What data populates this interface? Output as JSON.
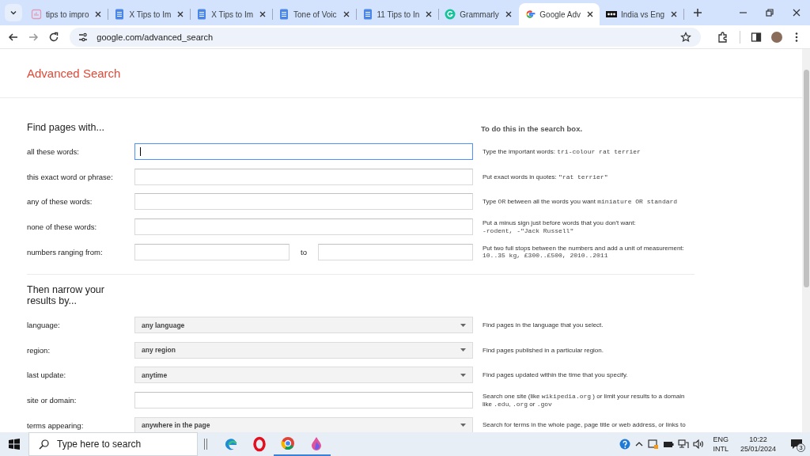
{
  "browser": {
    "tabs": [
      {
        "title": "tips to impro",
        "kind": "chart",
        "selected": false
      },
      {
        "title": "X Tips to Im",
        "kind": "doc",
        "selected": false
      },
      {
        "title": "X Tips to Im",
        "kind": "doc",
        "selected": false
      },
      {
        "title": "Tone of Voic",
        "kind": "doc",
        "selected": false
      },
      {
        "title": "11 Tips to In",
        "kind": "doc",
        "selected": false
      },
      {
        "title": "Grammarly",
        "kind": "grammarly",
        "selected": false
      },
      {
        "title": "Google Adv",
        "kind": "google",
        "selected": true
      },
      {
        "title": "India vs Eng",
        "kind": "dots",
        "selected": false
      }
    ],
    "url": "google.com/advanced_search"
  },
  "page": {
    "title": "Advanced Search",
    "sections": [
      {
        "heading": "Find pages with...",
        "side_heading": "To do this in the search box.",
        "rows": [
          {
            "label": "all these words:",
            "kind": "text",
            "focused": true,
            "hint": [
              {
                "kind": "text",
                "text": "Type the important words: "
              },
              {
                "kind": "code",
                "text": "tri-colour rat terrier"
              }
            ]
          },
          {
            "label": "this exact word or phrase:",
            "kind": "text",
            "focused": false,
            "hint": [
              {
                "kind": "text",
                "text": "Put exact words in quotes: "
              },
              {
                "kind": "code",
                "text": "\"rat terrier\""
              }
            ]
          },
          {
            "label": "any of these words:",
            "kind": "text",
            "focused": false,
            "hint": [
              {
                "kind": "text",
                "text": "Type "
              },
              {
                "kind": "code",
                "text": "OR"
              },
              {
                "kind": "text",
                "text": " between all the words you want "
              },
              {
                "kind": "code",
                "text": "miniature OR standard"
              }
            ]
          },
          {
            "label": "none of these words:",
            "kind": "text",
            "focused": false,
            "hint": [
              {
                "kind": "text",
                "text": "Put a minus sign just before words that you don't want: "
              },
              {
                "kind": "code",
                "text": "-rodent, -\"Jack Russell\""
              }
            ]
          },
          {
            "label": "numbers ranging from:",
            "kind": "range",
            "to": "to",
            "hint": [
              {
                "kind": "text",
                "text": "Put two full stops between the numbers and add a unit of measurement: "
              },
              {
                "kind": "code",
                "text": "10..35 kg, £300..£500, 2010..2011"
              }
            ]
          }
        ]
      },
      {
        "heading": "Then narrow your results by...",
        "rows": [
          {
            "label": "language:",
            "kind": "select",
            "value": "any language",
            "hint": [
              {
                "kind": "text",
                "text": "Find pages in the language that you select."
              }
            ]
          },
          {
            "label": "region:",
            "kind": "select",
            "value": "any region",
            "hint": [
              {
                "kind": "text",
                "text": "Find pages published in a particular region."
              }
            ]
          },
          {
            "label": "last update:",
            "kind": "select",
            "value": "anytime",
            "hint": [
              {
                "kind": "text",
                "text": "Find pages updated within the time that you specify."
              }
            ]
          },
          {
            "label": "site or domain:",
            "kind": "text",
            "focused": false,
            "hint": [
              {
                "kind": "text",
                "text": "Search one site (like "
              },
              {
                "kind": "code",
                "text": "wikipedia.org"
              },
              {
                "kind": "text",
                "text": " ) or limit your results to a domain like "
              },
              {
                "kind": "code",
                "text": ".edu"
              },
              {
                "kind": "text",
                "text": ", "
              },
              {
                "kind": "code",
                "text": ".org"
              },
              {
                "kind": "text",
                "text": " or "
              },
              {
                "kind": "code",
                "text": ".gov"
              }
            ]
          },
          {
            "label": "terms appearing:",
            "kind": "select",
            "value": "anywhere in the page",
            "hint": [
              {
                "kind": "text",
                "text": "Search for terms in the whole page, page title or web address, or links to"
              }
            ]
          }
        ]
      }
    ]
  },
  "taskbar": {
    "search_placeholder": "Type here to search",
    "lang": "ENG",
    "layout": "INTL",
    "time": "10:22",
    "date": "25/01/2024",
    "notifications": "3"
  }
}
